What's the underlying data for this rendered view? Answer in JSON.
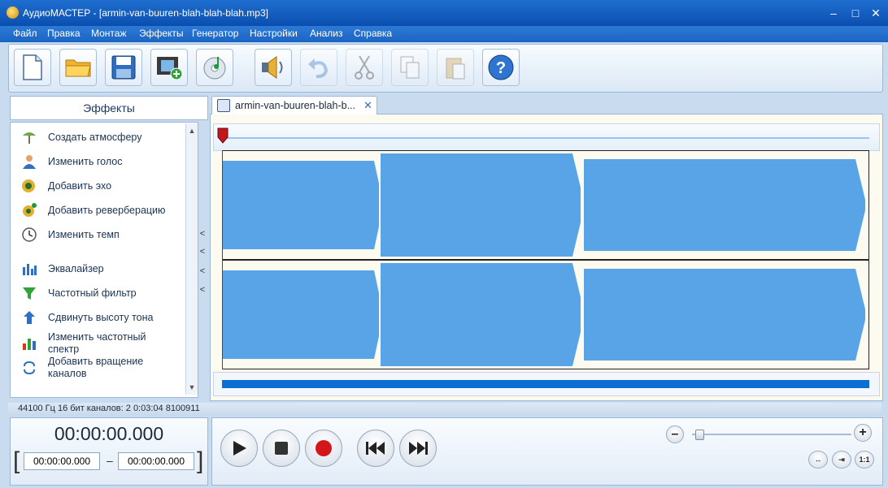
{
  "window": {
    "title": "АудиоМАСТЕР - [armin-van-buuren-blah-blah-blah.mp3]",
    "controls": {
      "minimize": "–",
      "maximize": "□",
      "close": "✕"
    }
  },
  "menu": [
    "Файл",
    "Правка",
    "Монтаж",
    "Эффекты",
    "Генератор",
    "Настройки",
    "Анализ",
    "Справка"
  ],
  "toolbar": {
    "buttons": [
      {
        "icon": "new-file-icon",
        "enabled": true
      },
      {
        "icon": "open-folder-icon",
        "enabled": true
      },
      {
        "icon": "save-icon",
        "enabled": true
      },
      {
        "icon": "add-video-icon",
        "enabled": true
      },
      {
        "icon": "cd-music-icon",
        "enabled": true
      },
      {
        "icon": "speaker-icon",
        "enabled": true
      },
      {
        "icon": "undo-icon",
        "enabled": false
      },
      {
        "icon": "scissors-icon",
        "enabled": false
      },
      {
        "icon": "copy-icon",
        "enabled": false
      },
      {
        "icon": "paste-icon",
        "enabled": false
      },
      {
        "icon": "help-icon",
        "enabled": true,
        "glyph": "?"
      }
    ]
  },
  "effects_panel": {
    "title": "Эффекты",
    "items": [
      {
        "label": "Создать атмосферу",
        "icon": "atmosphere-icon"
      },
      {
        "label": "Изменить голос",
        "icon": "voice-icon"
      },
      {
        "label": "Добавить эхо",
        "icon": "echo-icon"
      },
      {
        "label": "Добавить реверберацию",
        "icon": "reverb-icon"
      },
      {
        "label": "Изменить темп",
        "icon": "tempo-clock-icon"
      },
      {
        "label": "Эквалайзер",
        "icon": "equalizer-icon"
      },
      {
        "label": "Частотный фильтр",
        "icon": "filter-funnel-icon"
      },
      {
        "label": "Сдвинуть высоту тона",
        "icon": "pitch-arrow-icon"
      },
      {
        "label": "Изменить частотный спектр",
        "icon": "spectrum-icon"
      },
      {
        "label": "Добавить вращение каналов",
        "icon": "rotate-channels-icon"
      }
    ],
    "scroll_up": "▲",
    "scroll_down": "▼",
    "collapse_glyph": "<"
  },
  "tab": {
    "label": "armin-van-buuren-blah-b...",
    "close": "✕"
  },
  "status": {
    "text": "44100 Гц  16 бит  каналов: 2   0:03:04 8100911"
  },
  "time": {
    "current": "00:00:00.000",
    "start": "00:00:00.000",
    "end": "00:00:00.000",
    "separator": "–",
    "bracket_left": "[",
    "bracket_right": "]"
  },
  "zoom": {
    "minus": "–",
    "plus": "+",
    "fit": "↔",
    "sel": "⇥",
    "one": "1:1",
    "level": 0.02
  },
  "colors": {
    "waveform": "#59a4e6",
    "accent": "#0a6fd0",
    "playhead": "#c0161c",
    "record": "#d4161a"
  }
}
